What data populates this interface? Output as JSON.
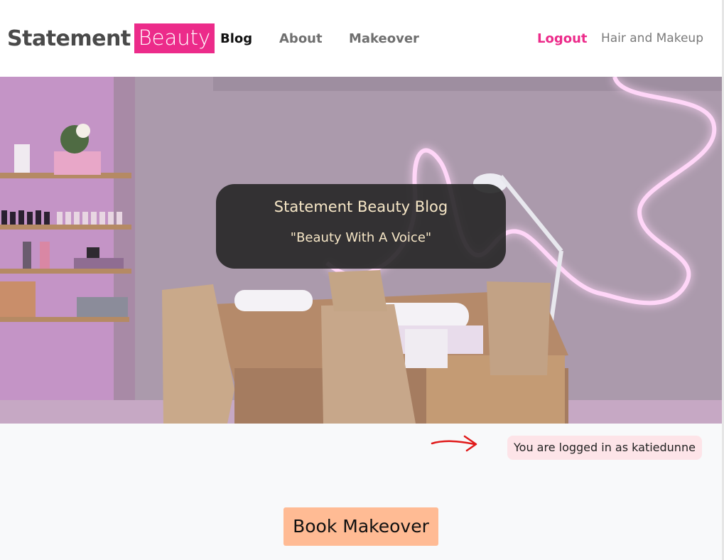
{
  "brand": {
    "main": "Statement",
    "accent": "Beauty",
    "accent_color": "#ec2b8a"
  },
  "nav": {
    "items": [
      {
        "label": "Blog",
        "active": true
      },
      {
        "label": "About",
        "active": false
      },
      {
        "label": "Makeover",
        "active": false
      }
    ],
    "logout_label": "Logout",
    "right_text": "Hair and Makeup"
  },
  "hero": {
    "title": "Statement Beauty Blog",
    "tagline": "\"Beauty With A Voice\""
  },
  "status": {
    "logged_in_text": "You are logged in as katiedunne"
  },
  "cta": {
    "book_label": "Book Makeover",
    "color": "#ffbb94"
  },
  "icons": {
    "annotation": "red-arrow-icon"
  }
}
